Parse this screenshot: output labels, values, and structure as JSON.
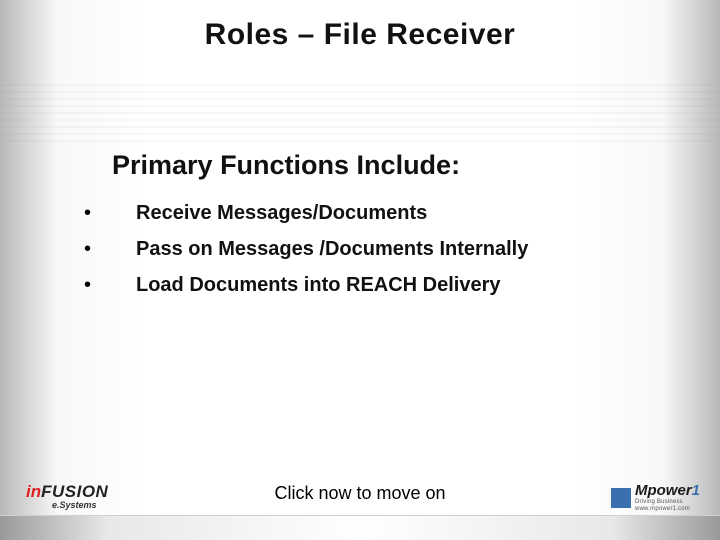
{
  "title": "Roles – File Receiver",
  "subtitle": "Primary Functions Include:",
  "bullets": [
    "Receive Messages/Documents",
    "Pass on Messages /Documents Internally",
    "Load Documents into REACH Delivery"
  ],
  "cta": "Click now to move on",
  "logo_left": {
    "prefix": "in",
    "main": "FUSION",
    "sub": "e.Systems"
  },
  "logo_right": {
    "name_main": "Mpower",
    "name_suffix": "1",
    "tagline1": "Driving Business",
    "tagline2": "www.mpower1.com"
  }
}
